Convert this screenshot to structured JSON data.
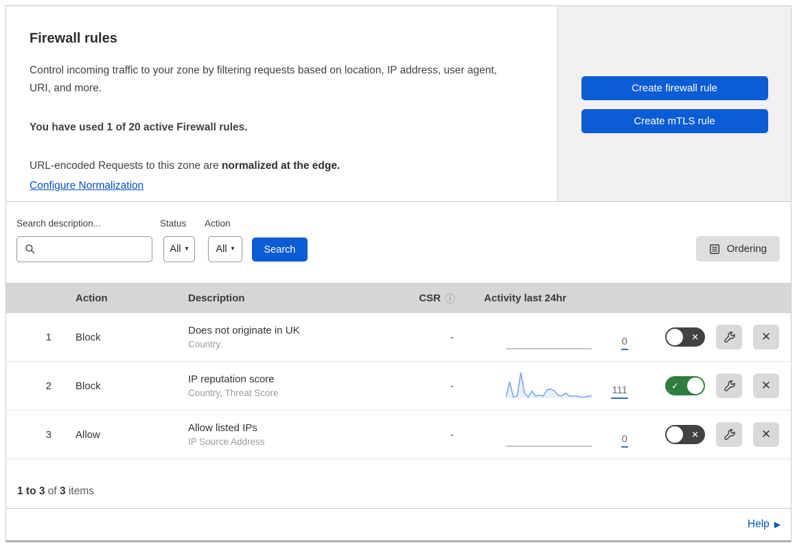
{
  "header": {
    "title": "Firewall rules",
    "description": "Control incoming traffic to your zone by filtering requests based on location, IP address, user agent, URI, and more.",
    "usage": "You have used 1 of 20 active Firewall rules.",
    "normalization_prefix": "URL-encoded Requests to this zone are ",
    "normalization_bold": "normalized at the edge.",
    "normalization_link": "Configure Normalization",
    "create_firewall_button": "Create firewall rule",
    "create_mtls_button": "Create mTLS rule"
  },
  "filters": {
    "search_label": "Search description...",
    "search_value": "",
    "status_label": "Status",
    "status_value": "All",
    "action_label": "Action",
    "action_value": "All",
    "search_button": "Search",
    "ordering_button": "Ordering"
  },
  "table": {
    "headers": {
      "action": "Action",
      "description": "Description",
      "csr": "CSR",
      "activity": "Activity last 24hr"
    },
    "rows": [
      {
        "priority": "1",
        "action": "Block",
        "description": "Does not originate in UK",
        "fields": "Country",
        "csr": "-",
        "activity": "0",
        "enabled": false
      },
      {
        "priority": "2",
        "action": "Block",
        "description": "IP reputation score",
        "fields": "Country, Threat Score",
        "csr": "-",
        "activity": "111",
        "enabled": true
      },
      {
        "priority": "3",
        "action": "Allow",
        "description": "Allow listed IPs",
        "fields": "IP Source Address",
        "csr": "-",
        "activity": "0",
        "enabled": false
      }
    ]
  },
  "footer": {
    "range": "1 to 3",
    "of": " of ",
    "total": "3",
    "items": " items"
  },
  "help": {
    "label": "Help"
  },
  "icons": {
    "chevron_down": "▾",
    "info": "ⓘ",
    "toggle_off_x": "✕",
    "toggle_on_check": "✓",
    "delete": "✕",
    "help_arrow": "▶"
  },
  "colors": {
    "primary_blue": "#0b5cd5",
    "link_blue": "#0051c3",
    "toggle_on_green": "#2e7d3e",
    "toggle_off_gray": "#424242",
    "sparkline_blue": "#7aa7ec",
    "sparkline_fill": "#e9f0fb",
    "table_header_gray": "#d6d6d6"
  },
  "chart_data": {
    "type": "line",
    "title": "Activity last 24hr sparkline (rule 2: IP reputation score)",
    "x": [
      0,
      1,
      2,
      3,
      4,
      5,
      6,
      7,
      8,
      9,
      10,
      11,
      12,
      13,
      14,
      15,
      16,
      17,
      18,
      19,
      20,
      21,
      22,
      23
    ],
    "values": [
      1,
      16,
      1,
      2,
      25,
      5,
      1,
      7,
      2,
      3,
      2,
      8,
      9,
      7,
      3,
      2,
      5,
      2,
      2,
      2,
      1,
      1,
      2,
      2
    ],
    "total": 111,
    "xlabel": "",
    "ylabel": "",
    "legend": false,
    "grid": false
  }
}
